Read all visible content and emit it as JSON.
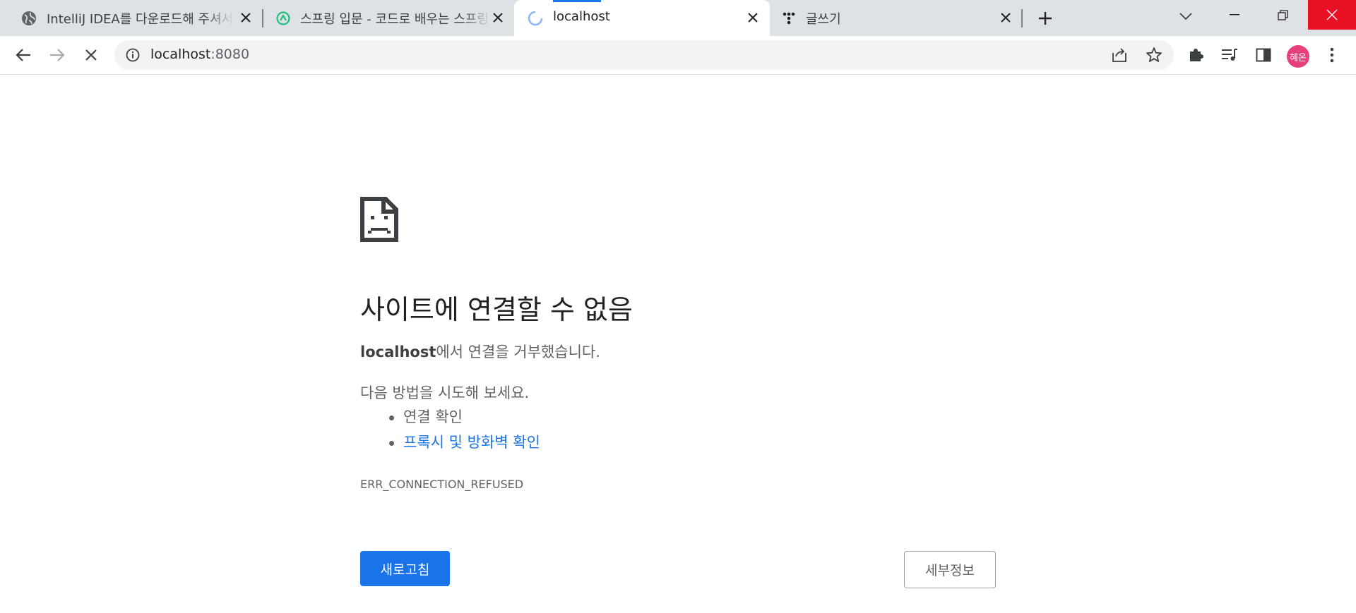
{
  "tabs": [
    {
      "title": "IntelliJ IDEA를 다운로드해 주셔서 감사합니다!",
      "icon": "globe-icon"
    },
    {
      "title": "스프링 입문 - 코드로 배우는 스프링 부트",
      "icon": "inflearn-icon"
    },
    {
      "title": "localhost",
      "icon": "loading-spinner-icon",
      "active": true
    },
    {
      "title": "글쓰기",
      "icon": "tistory-icon"
    }
  ],
  "address_bar": {
    "host": "localhost",
    "port": ":8080"
  },
  "profile": {
    "initials": "혜온",
    "color": "#e8407a"
  },
  "error_page": {
    "title": "사이트에 연결할 수 없음",
    "host_bold": "localhost",
    "description_suffix": "에서 연결을 거부했습니다.",
    "try_heading": "다음 방법을 시도해 보세요.",
    "suggestions": [
      {
        "text": "연결 확인",
        "is_link": false
      },
      {
        "text": "프록시 및 방화벽 확인",
        "is_link": true
      }
    ],
    "error_code": "ERR_CONNECTION_REFUSED",
    "reload_button": "새로고침",
    "details_button": "세부정보"
  },
  "colors": {
    "accent": "#1a73e8",
    "close_red": "#e81123",
    "tabstrip": "#dee1e6"
  }
}
